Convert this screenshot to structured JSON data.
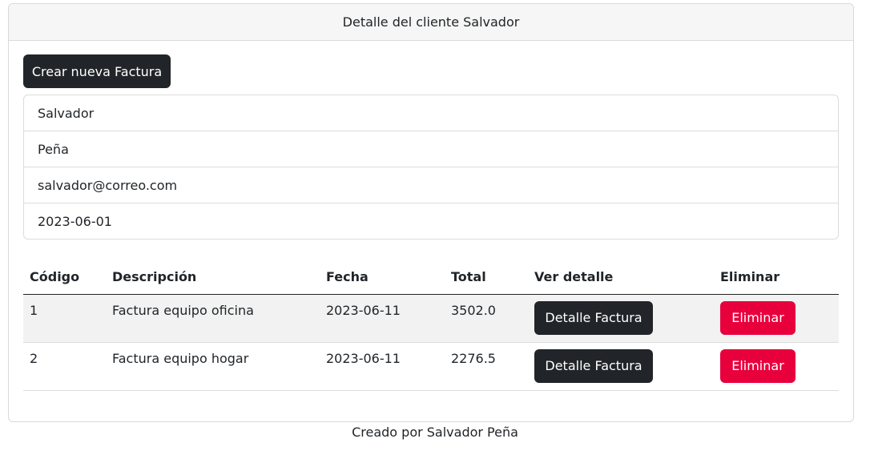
{
  "header": {
    "title": "Detalle del cliente Salvador"
  },
  "actions": {
    "create_invoice_label": "Crear nueva Factura"
  },
  "client": {
    "first_name": "Salvador",
    "last_name": "Peña",
    "email": "salvador@correo.com",
    "created_at": "2023-06-01"
  },
  "table": {
    "columns": [
      "Código",
      "Descripción",
      "Fecha",
      "Total",
      "Ver detalle",
      "Eliminar"
    ],
    "rows": [
      {
        "code": "1",
        "description": "Factura equipo oficina",
        "date": "2023-06-11",
        "total": "3502.0",
        "detail_label": "Detalle Factura",
        "delete_label": "Eliminar"
      },
      {
        "code": "2",
        "description": "Factura equipo hogar",
        "date": "2023-06-11",
        "total": "2276.5",
        "detail_label": "Detalle Factura",
        "delete_label": "Eliminar"
      }
    ]
  },
  "footer": {
    "text": "Creado por Salvador Peña"
  },
  "colors": {
    "dark_button": "#212529",
    "danger_button": "#e8003d",
    "header_bg": "#f6f6f6",
    "striped_row": "#f2f2f2"
  }
}
